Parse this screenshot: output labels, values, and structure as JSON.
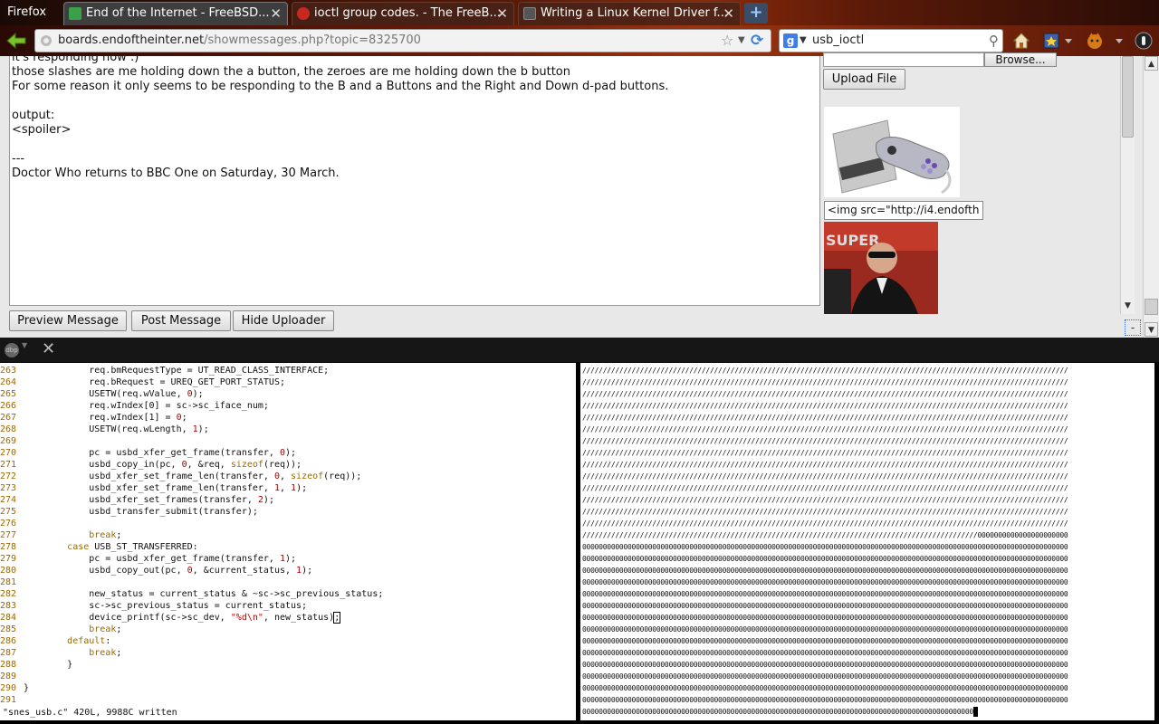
{
  "browser": {
    "menu_button": "Firefox",
    "tabs": [
      {
        "title": "End of the Internet - FreeBSD...",
        "active": true,
        "favicon_color": "#3aa04a"
      },
      {
        "title": "ioctl group codes. - The FreeB...",
        "active": false,
        "favicon_color": "#c8281e"
      },
      {
        "title": "Writing a Linux Kernel Driver f...",
        "active": false,
        "favicon_color": "#555555"
      }
    ],
    "tab_close_glyph": "✕",
    "new_tab_glyph": "+",
    "url": {
      "host": "boards.endoftheinter.net",
      "path": "/showmessages.php?topic=8325700"
    },
    "search": {
      "engine": "Google",
      "query": "usb_ioctl"
    },
    "icons": [
      "back-icon",
      "star-icon",
      "reload-icon",
      "search-icon",
      "home-icon",
      "bookmarks-icon",
      "addon-icon",
      "menu-icon"
    ]
  },
  "page": {
    "message_lines": [
      "it's responding now :)",
      "those slashes are me holding down the a button, the zeroes are me holding down the b button",
      "For some reason it only seems to be responding to the B and a Buttons and the Right and Down d-pad buttons.",
      "",
      "output:",
      "<spoiler>",
      "",
      "---",
      "Doctor Who returns to BBC One on Saturday, 30 March."
    ],
    "buttons": {
      "preview": "Preview Message",
      "post": "Post Message",
      "hide_uploader": "Hide Uploader"
    },
    "uploader": {
      "browse": "Browse...",
      "upload": "Upload File",
      "img_tag": "<img src=\"http://i4.endofth"
    },
    "minimize_marker": "-"
  },
  "terminal": {
    "vim_lines": [
      {
        "n": "263",
        "t": "            req.bmRequestType = UT_READ_CLASS_INTERFACE;"
      },
      {
        "n": "264",
        "t": "            req.bRequest = UREQ_GET_PORT_STATUS;"
      },
      {
        "n": "265",
        "t": "            USETW(req.wValue, 0);"
      },
      {
        "n": "266",
        "t": "            req.wIndex[0] = sc->sc_iface_num;"
      },
      {
        "n": "267",
        "t": "            req.wIndex[1] = 0;"
      },
      {
        "n": "268",
        "t": "            USETW(req.wLength, 1);"
      },
      {
        "n": "269",
        "t": ""
      },
      {
        "n": "270",
        "t": "            pc = usbd_xfer_get_frame(transfer, 0);"
      },
      {
        "n": "271",
        "t": "            usbd_copy_in(pc, 0, &req, sizeof(req));"
      },
      {
        "n": "272",
        "t": "            usbd_xfer_set_frame_len(transfer, 0, sizeof(req));"
      },
      {
        "n": "273",
        "t": "            usbd_xfer_set_frame_len(transfer, 1, 1);"
      },
      {
        "n": "274",
        "t": "            usbd_xfer_set_frames(transfer, 2);"
      },
      {
        "n": "275",
        "t": "            usbd_transfer_submit(transfer);"
      },
      {
        "n": "276",
        "t": ""
      },
      {
        "n": "277",
        "t": "            break;"
      },
      {
        "n": "278",
        "t": "        case USB_ST_TRANSFERRED:"
      },
      {
        "n": "279",
        "t": "            pc = usbd_xfer_get_frame(transfer, 1);"
      },
      {
        "n": "280",
        "t": "            usbd_copy_out(pc, 0, &current_status, 1);"
      },
      {
        "n": "281",
        "t": ""
      },
      {
        "n": "282",
        "t": "            new_status = current_status & ~sc->sc_previous_status;"
      },
      {
        "n": "283",
        "t": "            sc->sc_previous_status = current_status;"
      },
      {
        "n": "284",
        "t": "            device_printf(sc->sc_dev, \"%d\\n\", new_status);"
      },
      {
        "n": "285",
        "t": "            break;"
      },
      {
        "n": "286",
        "t": "        default:"
      },
      {
        "n": "287",
        "t": "            break;"
      },
      {
        "n": "288",
        "t": "        }"
      },
      {
        "n": "289",
        "t": ""
      },
      {
        "n": "290",
        "t": "}"
      },
      {
        "n": "291",
        "t": ""
      }
    ],
    "vim_status": "\"snes_usb.c\" 420L, 9988C written",
    "output_slash_lines": 14,
    "output_slash_char": "/",
    "output_zero_char": "0",
    "output_cols": 118,
    "output_transition_zeros": 22,
    "output_zero_lines": 14,
    "output_last_zeros": 95
  }
}
